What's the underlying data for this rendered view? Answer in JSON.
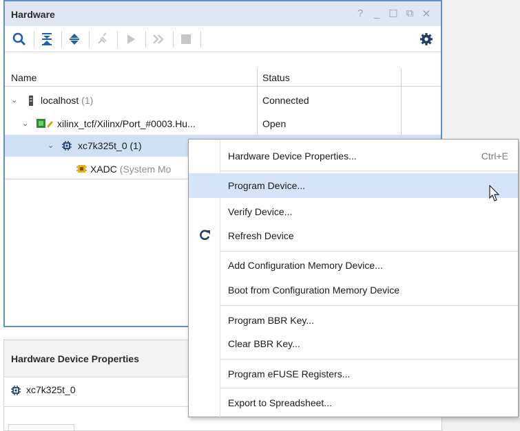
{
  "hardware_panel": {
    "title": "Hardware",
    "window_controls": [
      "?",
      "_",
      "☐",
      "⧉",
      "✕"
    ],
    "toolbar_icons": [
      "search-icon",
      "collapse-all-icon",
      "expand-all-icon",
      "auto-connect-icon",
      "run-icon",
      "step-icon",
      "stop-icon",
      "gear-icon"
    ]
  },
  "table": {
    "columns": [
      "Name",
      "Status"
    ],
    "rows": [
      {
        "name": "localhost",
        "count": "(1)",
        "status": "Connected"
      },
      {
        "name": "xilinx_tcf/Xilinx/Port_#0003.Hu...",
        "count": "",
        "status": "Open"
      },
      {
        "name": "xc7k325t_0",
        "count": "(1)",
        "status": ""
      },
      {
        "name": "XADC",
        "count": "(System Mo",
        "status": ""
      }
    ]
  },
  "properties_panel": {
    "title": "Hardware Device Properties",
    "device": "xc7k325t_0"
  },
  "context_menu": {
    "items": [
      {
        "label": "Hardware Device Properties...",
        "shortcut": "Ctrl+E"
      },
      {
        "label": "Program Device...",
        "shortcut": ""
      },
      {
        "label": "Verify Device...",
        "shortcut": ""
      },
      {
        "label": "Refresh Device",
        "shortcut": ""
      },
      {
        "label": "Add Configuration Memory Device...",
        "shortcut": ""
      },
      {
        "label": "Boot from Configuration Memory Device",
        "shortcut": ""
      },
      {
        "label": "Program BBR Key...",
        "shortcut": ""
      },
      {
        "label": "Clear BBR Key...",
        "shortcut": ""
      },
      {
        "label": "Program eFUSE Registers...",
        "shortcut": ""
      },
      {
        "label": "Export to Spreadsheet...",
        "shortcut": ""
      }
    ]
  },
  "colors": {
    "accent_border": "#5d8ed3",
    "selection": "#cfe0f5",
    "menu_highlight": "#d5e4f8",
    "icon_blue": "#1f5fa8"
  }
}
